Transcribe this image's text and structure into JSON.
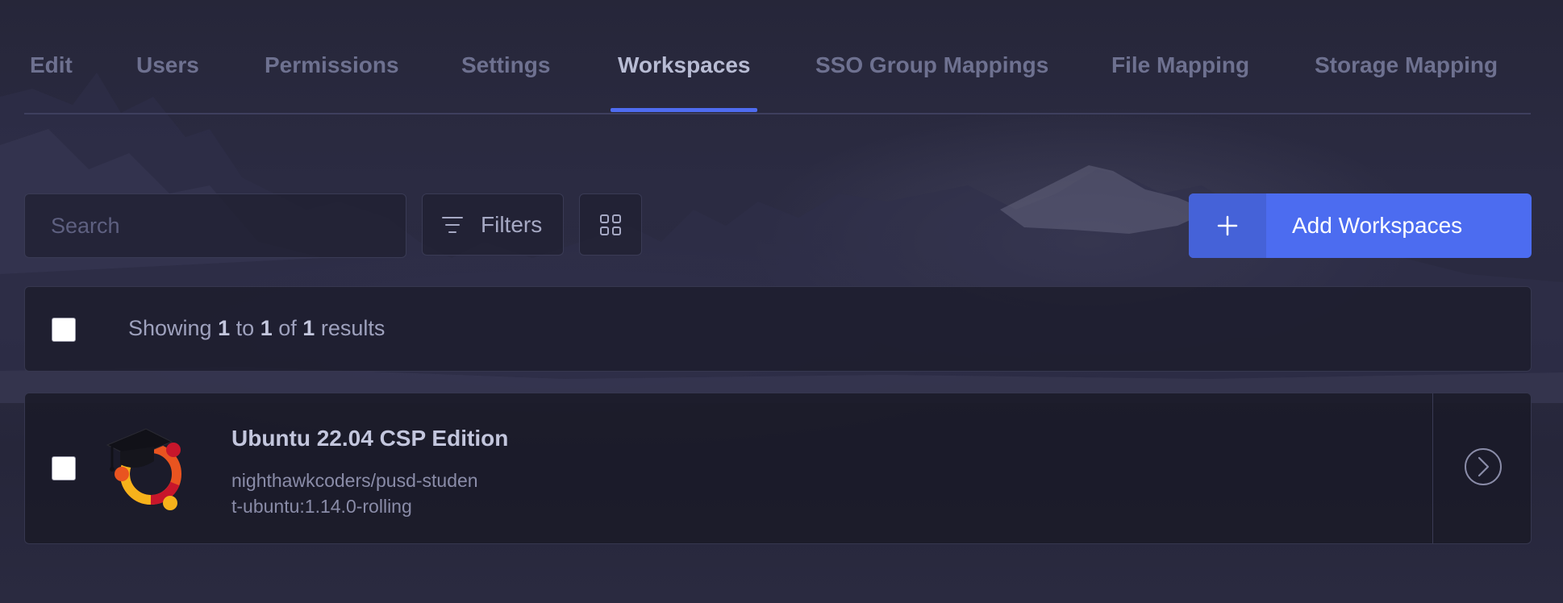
{
  "tabs": [
    {
      "label": "Edit"
    },
    {
      "label": "Users"
    },
    {
      "label": "Permissions"
    },
    {
      "label": "Settings"
    },
    {
      "label": "Workspaces",
      "active": true
    },
    {
      "label": "SSO Group Mappings"
    },
    {
      "label": "File Mapping"
    },
    {
      "label": "Storage Mapping"
    }
  ],
  "toolbar": {
    "search_placeholder": "Search",
    "filters_label": "Filters",
    "add_label": "Add Workspaces"
  },
  "results": {
    "prefix": "Showing",
    "from": "1",
    "to_word": "to",
    "to": "1",
    "of_word": "of",
    "total": "1",
    "suffix": "results"
  },
  "workspaces": [
    {
      "name": "Ubuntu 22.04 CSP Edition",
      "image_line1": "nighthawkcoders/pusd-studen",
      "image_line2": "t-ubuntu:1.14.0-rolling",
      "icon": "ubuntu-graduation-cap-logo"
    }
  ],
  "colors": {
    "accent": "#4c6cf0",
    "background": "#24243a"
  },
  "icons": {
    "filter": "filter-lines-icon",
    "grid": "grid-view-icon",
    "plus": "plus-icon",
    "open": "chevron-right-circle-icon"
  }
}
